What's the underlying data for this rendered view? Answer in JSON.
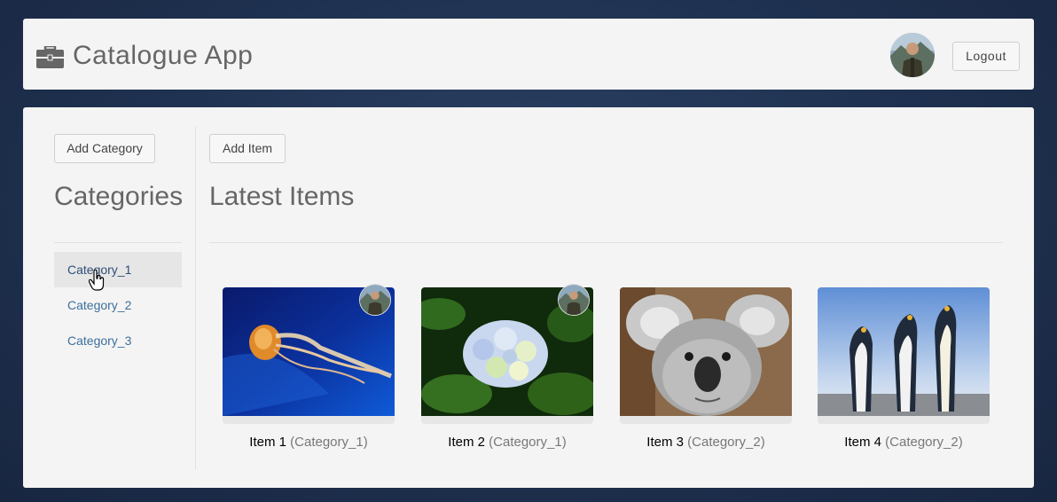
{
  "header": {
    "title": "Catalogue App",
    "logout_label": "Logout"
  },
  "sidebar": {
    "add_button": "Add Category",
    "title": "Categories",
    "items": [
      {
        "label": "Category_1"
      },
      {
        "label": "Category_2"
      },
      {
        "label": "Category_3"
      }
    ]
  },
  "content": {
    "add_button": "Add Item",
    "title": "Latest Items",
    "items": [
      {
        "name": "Item 1",
        "category": "(Category_1)",
        "image": "jellyfish"
      },
      {
        "name": "Item 2",
        "category": "(Category_1)",
        "image": "hydrangea"
      },
      {
        "name": "Item 3",
        "category": "(Category_2)",
        "image": "koala"
      },
      {
        "name": "Item 4",
        "category": "(Category_2)",
        "image": "penguins"
      }
    ]
  },
  "icons": {
    "brand": "briefcase-icon",
    "cursor": "hand-pointer-icon"
  },
  "colors": {
    "background": "#1f3150",
    "panel": "#f4f4f4",
    "link": "#3d6f9c"
  }
}
